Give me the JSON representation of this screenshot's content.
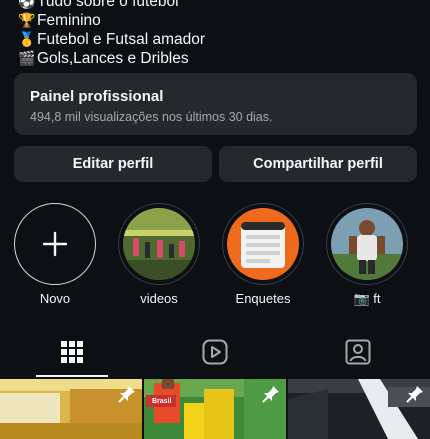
{
  "bio": {
    "lines": [
      {
        "emoji": "⚽",
        "text": "Tudo sobre o futebol"
      },
      {
        "emoji": "🏆",
        "text": "Feminino"
      },
      {
        "emoji": "🥇",
        "text": "Futebol e Futsal amador"
      },
      {
        "emoji": "🎬",
        "text": "Gols,Lances e Dribles"
      }
    ]
  },
  "professional_panel": {
    "title": "Painel profissional",
    "subtitle": "494,8 mil visualizações nos últimos 30 dias."
  },
  "actions": {
    "edit_profile": "Editar perfil",
    "share_profile": "Compartilhar perfil"
  },
  "highlights": [
    {
      "label": "Novo",
      "icon": "plus-icon"
    },
    {
      "label": "videos"
    },
    {
      "label": "Enquetes"
    },
    {
      "label": "📷 ft"
    }
  ],
  "tabs": [
    {
      "icon": "grid-icon",
      "active": true
    },
    {
      "icon": "reels-icon",
      "active": false
    },
    {
      "icon": "tagged-icon",
      "active": false
    }
  ],
  "grid": {
    "tile_2_overlay_text": "Brasil"
  },
  "colors": {
    "background": "#0c1014",
    "button": "#25292e",
    "text": "#f5f5f5",
    "muted": "#a8a8a8"
  }
}
